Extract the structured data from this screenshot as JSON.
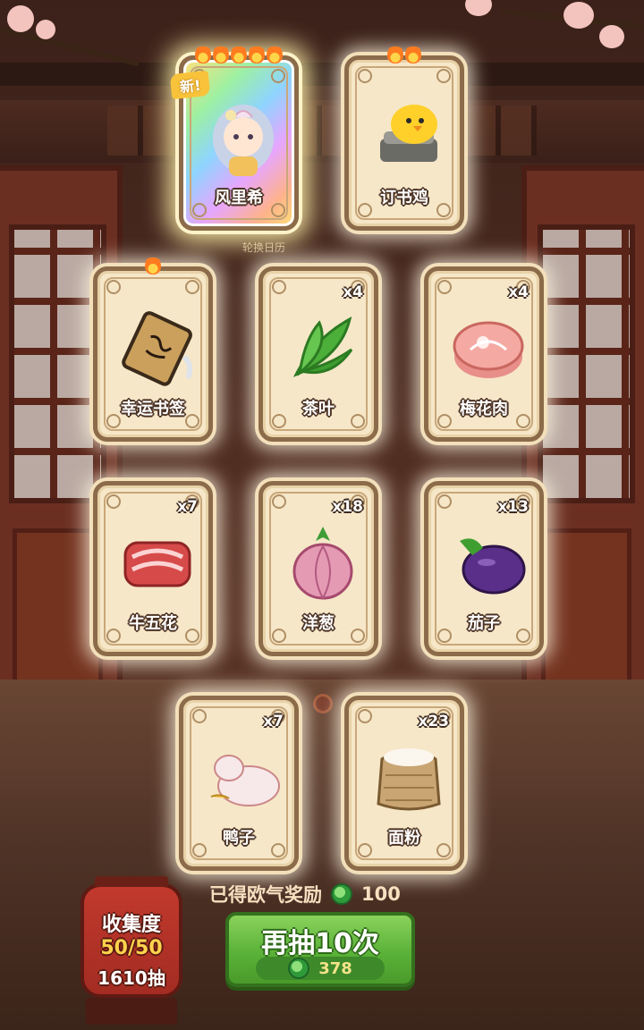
{
  "cards": [
    {
      "name": "风里希",
      "qty": "",
      "flames": 5,
      "isNew": true,
      "rainbow": true,
      "icon": "character-portrait"
    },
    {
      "name": "订书鸡",
      "qty": "",
      "flames": 2,
      "isNew": false,
      "rainbow": false,
      "icon": "stapler-chick"
    },
    {
      "name": "幸运书签",
      "qty": "",
      "flames": 1,
      "isNew": false,
      "rainbow": false,
      "icon": "bookmark"
    },
    {
      "name": "茶叶",
      "qty": "x4",
      "flames": 0,
      "isNew": false,
      "rainbow": false,
      "icon": "tea-leaf"
    },
    {
      "name": "梅花肉",
      "qty": "x4",
      "flames": 0,
      "isNew": false,
      "rainbow": false,
      "icon": "pork-shoulder"
    },
    {
      "name": "牛五花",
      "qty": "x7",
      "flames": 0,
      "isNew": false,
      "rainbow": false,
      "icon": "beef-slice"
    },
    {
      "name": "洋葱",
      "qty": "x18",
      "flames": 0,
      "isNew": false,
      "rainbow": false,
      "icon": "onion"
    },
    {
      "name": "茄子",
      "qty": "x13",
      "flames": 0,
      "isNew": false,
      "rainbow": false,
      "icon": "eggplant"
    },
    {
      "name": "鸭子",
      "qty": "x7",
      "flames": 0,
      "isNew": false,
      "rainbow": false,
      "icon": "duck"
    },
    {
      "name": "面粉",
      "qty": "x23",
      "flames": 0,
      "isNew": false,
      "rainbow": false,
      "icon": "flour-sack"
    }
  ],
  "new_tag": "新!",
  "rotation_label": "轮换日历",
  "reward": {
    "label": "已得欧气奖励",
    "amount": "100"
  },
  "redraw": {
    "label": "再抽10次",
    "cost": "378"
  },
  "collection": {
    "title": "收集度",
    "progress": "50/50",
    "draws": "1610抽"
  },
  "colors": {
    "accent_green": "#5ab238",
    "card_bg": "#f6e7c8",
    "lantern_red": "#c2392d",
    "coin_green": "#2f9a3a"
  }
}
